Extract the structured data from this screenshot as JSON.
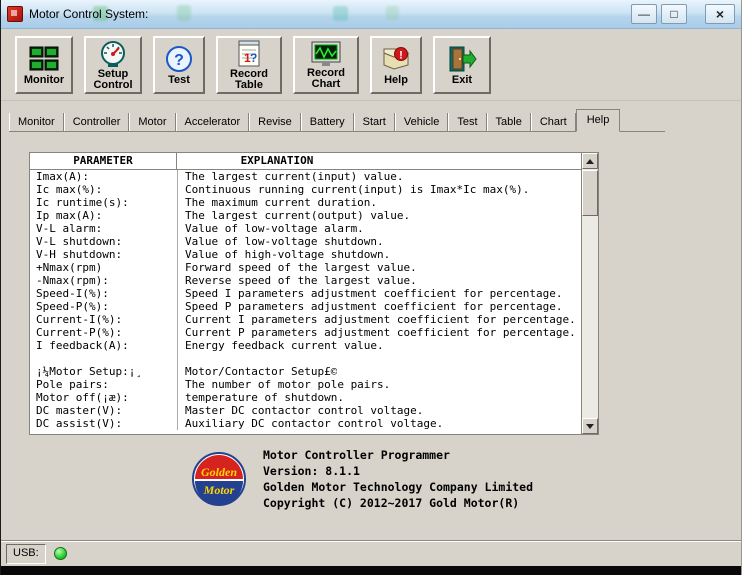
{
  "window": {
    "title": "Motor Control System:",
    "controls": {
      "minimize": "—",
      "maximize": "□",
      "close": "×"
    }
  },
  "toolbar": {
    "buttons": [
      {
        "label": "Monitor",
        "icon": "monitors-grid-icon"
      },
      {
        "label": "Setup Control",
        "icon": "gauge-icon"
      },
      {
        "label": "Test",
        "icon": "question-circle-icon"
      },
      {
        "label": "Record Table",
        "icon": "notepad-icon"
      },
      {
        "label": "Record Chart",
        "icon": "oscilloscope-icon"
      },
      {
        "label": "Help",
        "icon": "book-exclamation-icon"
      },
      {
        "label": "Exit",
        "icon": "exit-door-icon"
      }
    ]
  },
  "tabs": {
    "items": [
      "Monitor",
      "Controller",
      "Motor",
      "Accelerator",
      "Revise",
      "Battery",
      "Start",
      "Vehicle",
      "Test",
      "Table",
      "Chart",
      "Help"
    ],
    "active": "Help"
  },
  "table": {
    "headers": [
      "PARAMETER",
      "EXPLANATION"
    ],
    "rows": [
      [
        "Imax(A):",
        "The largest current(input) value."
      ],
      [
        "Ic max(%):",
        "Continuous running current(input) is Imax*Ic max(%)."
      ],
      [
        "Ic runtime(s):",
        "The maximum current duration."
      ],
      [
        "Ip max(A):",
        "The largest current(output) value."
      ],
      [
        "V-L alarm:",
        "Value of low-voltage alarm."
      ],
      [
        "V-L shutdown:",
        "Value of low-voltage shutdown."
      ],
      [
        "V-H shutdown:",
        "Value of high-voltage shutdown."
      ],
      [
        "+Nmax(rpm)",
        "Forward speed of the largest value."
      ],
      [
        "-Nmax(rpm):",
        "Reverse speed of the largest value."
      ],
      [
        "Speed-I(%):",
        "Speed I parameters adjustment coefficient for percentage."
      ],
      [
        "Speed-P(%):",
        "Speed P parameters adjustment coefficient for percentage."
      ],
      [
        "Current-I(%):",
        "Current I parameters adjustment coefficient for percentage."
      ],
      [
        "Current-P(%):",
        "Current P parameters adjustment coefficient for percentage."
      ],
      [
        "I feedback(A):",
        "Energy feedback current value."
      ],
      [
        "",
        ""
      ],
      [
        "¡¼Motor Setup:¡¸",
        "Motor/Contactor Setup£©"
      ],
      [
        "Pole pairs:",
        "The number of motor pole pairs."
      ],
      [
        "Motor off(¡æ):",
        "temperature of shutdown."
      ],
      [
        "DC master(V):",
        "Master DC contactor control voltage."
      ],
      [
        "DC assist(V):",
        "Auxiliary DC contactor control voltage."
      ]
    ]
  },
  "about": {
    "logo_text_top": "Golden",
    "logo_text_bottom": "Motor",
    "lines": [
      "Motor Controller Programmer",
      "Version: 8.1.1",
      "Golden Motor Technology Company Limited",
      "Copyright (C) 2012~2017 Gold Motor(R)"
    ]
  },
  "status": {
    "usb_label": "USB:",
    "led_color": "#28cf28"
  },
  "colors": {
    "window_bg": "#d7d3cb",
    "titlebar": "#b5d4ec",
    "panel_bg": "#ffffff",
    "led": "#28cf28"
  }
}
